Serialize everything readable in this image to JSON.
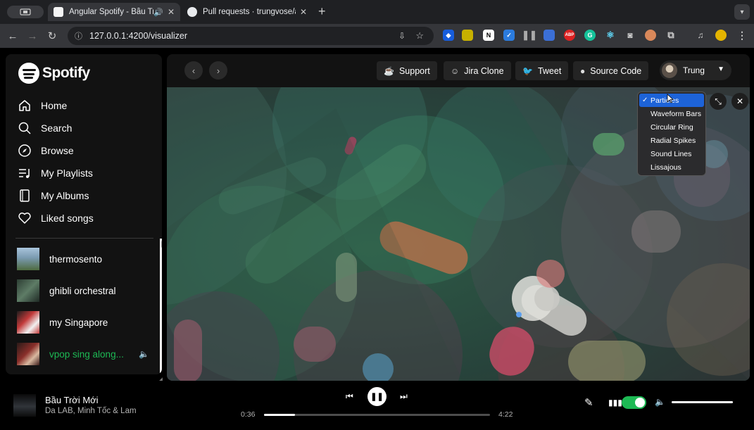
{
  "browser": {
    "tabs": [
      {
        "title": "Angular Spotify - Bầu Trời",
        "active": true
      },
      {
        "title": "Pull requests · trungvose/ang",
        "active": false
      }
    ],
    "url": "127.0.0.1:4200/visualizer",
    "new_tab": "+"
  },
  "sidebar": {
    "logo_text": "Spotify",
    "nav": [
      {
        "label": "Home",
        "icon": "home-icon"
      },
      {
        "label": "Search",
        "icon": "search-icon"
      },
      {
        "label": "Browse",
        "icon": "compass-icon"
      },
      {
        "label": "My Playlists",
        "icon": "playlist-icon"
      },
      {
        "label": "My Albums",
        "icon": "album-icon"
      },
      {
        "label": "Liked songs",
        "icon": "heart-icon"
      }
    ],
    "playlists": [
      {
        "name": "thermosento",
        "color": "#7a9ab0",
        "active": false
      },
      {
        "name": "ghibli orchestral",
        "color": "#4e6a55",
        "active": false
      },
      {
        "name": "my Singapore",
        "color": "#c23a3a",
        "active": false
      },
      {
        "name": "vpop sing along...",
        "color": "#8a2f2a",
        "active": true
      }
    ]
  },
  "header": {
    "buttons": [
      {
        "label": "Support",
        "icon": "cup-icon"
      },
      {
        "label": "Jira Clone",
        "icon": "smile-icon"
      },
      {
        "label": "Tweet",
        "icon": "twitter-icon"
      },
      {
        "label": "Source Code",
        "icon": "github-icon"
      }
    ],
    "user": "Trung"
  },
  "visualizer": {
    "options": [
      "Particles",
      "Waveform Bars",
      "Circular Ring",
      "Radial Spikes",
      "Sound Lines",
      "Lissajous"
    ],
    "selected": "Particles",
    "check": "✓"
  },
  "player": {
    "title": "Bầu Trời Mới",
    "artist": "Da LAB, Minh Tốc & Lam",
    "elapsed": "0:36",
    "duration": "4:22",
    "progress": 0.137,
    "volume": 1.0,
    "visualizer_on": true
  },
  "colors": {
    "accent": "#1db954",
    "menu_selected": "#1d63d8"
  }
}
